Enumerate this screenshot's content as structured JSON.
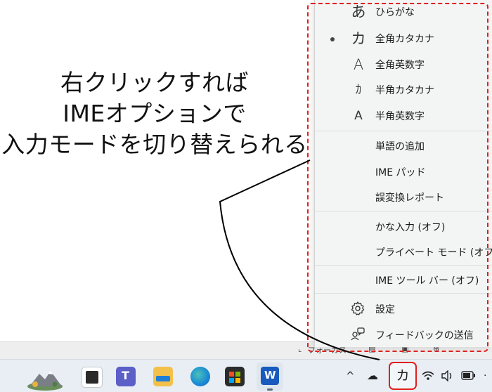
{
  "annotation": {
    "lines": [
      "右クリックすれば",
      "IMEオプションで",
      "入力モードを切り替えられる"
    ]
  },
  "ime_menu": {
    "modes": [
      {
        "glyph": "あ",
        "label": "ひらがな",
        "selected": false
      },
      {
        "glyph": "カ",
        "label": "全角カタカナ",
        "selected": true
      },
      {
        "glyph": "A",
        "label": "全角英数字",
        "selected": false
      },
      {
        "glyph": "ｶ",
        "label": "半角カタカナ",
        "selected": false
      },
      {
        "glyph": "A",
        "label": "半角英数字",
        "selected": false
      }
    ],
    "tools": [
      "単語の追加",
      "IME パッド",
      "誤変換レポート"
    ],
    "toggles": [
      "かな入力 (オフ)",
      "プライベート モード (オフ)"
    ],
    "toolbar": "IME ツール バー (オフ)",
    "settings": "設定",
    "feedback": "フィードバックの送信"
  },
  "status_strip": {
    "focus_label": "フォーカス"
  },
  "taskbar": {
    "ime_indicator": "カ",
    "tray_chevron": "^"
  },
  "colors": {
    "highlight": "#e0201c",
    "menu_bg": "#f3f5f4",
    "taskbar_bg": "#e8eef4"
  }
}
